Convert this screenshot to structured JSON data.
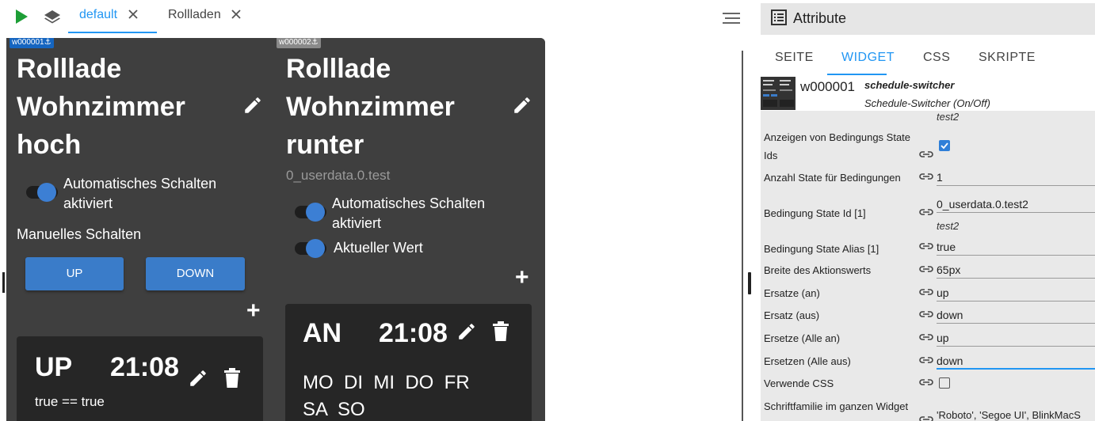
{
  "editor": {
    "tabs": [
      {
        "label": "default",
        "active": true
      },
      {
        "label": "Rollladen",
        "active": false
      }
    ]
  },
  "widgets": [
    {
      "id_label": "w000001⚓",
      "title_lines": [
        "Rolllade",
        "Wohnzimmer",
        "hoch"
      ],
      "auto_switch_label_1": "Automatisches Schalten",
      "auto_switch_label_2": "aktiviert",
      "manual_label": "Manuelles Schalten",
      "btn_up": "UP",
      "btn_down": "DOWN",
      "plus": "+",
      "card": {
        "action": "UP",
        "time": "21:08",
        "condition": "true == true"
      }
    },
    {
      "id_label": "w000002⚓",
      "title_lines": [
        "Rolllade",
        "Wohnzimmer",
        "runter"
      ],
      "subtitle": "0_userdata.0.test",
      "auto_switch_label_1": "Automatisches Schalten",
      "auto_switch_label_2": "aktiviert",
      "current_value_label": "Aktueller Wert",
      "plus": "+",
      "card": {
        "action": "AN",
        "time": "21:08",
        "days_line1": "MO  DI  MI  DO  FR",
        "days_line2": "SA  SO"
      }
    }
  ],
  "panel": {
    "title": "Attribute",
    "tabs": [
      "SEITE",
      "WIDGET",
      "CSS",
      "SKRIPTE"
    ],
    "active_tab": "WIDGET",
    "widget_id": "w000001",
    "widget_type": "schedule-switcher",
    "widget_desc": "Schedule-Switcher (On/Off)",
    "hint_top": "test2",
    "attributes": {
      "show_cond_label_1": "Anzeigen von Bedingungs State",
      "show_cond_label_2": "Ids",
      "show_cond_checked": true,
      "num_states_label": "Anzahl State für Bedingungen",
      "num_states_value": "1",
      "cond_id_label": "Bedingung State Id [1]",
      "cond_id_value": "0_userdata.0.test2",
      "cond_id_hint": "test2",
      "cond_alias_label": "Bedingung State Alias [1]",
      "cond_alias_value": "true",
      "action_width_label": "Breite des Aktionswerts",
      "action_width_value": "65px",
      "replace_on_label": "Ersatze (an)",
      "replace_on_value": "up",
      "replace_off_label": "Ersatz (aus)",
      "replace_off_value": "down",
      "replace_all_on_label": "Ersetze (Alle an)",
      "replace_all_on_value": "up",
      "replace_all_off_label": "Ersetzen (Alle aus)",
      "replace_all_off_value": "down",
      "use_css_label": "Verwende CSS",
      "use_css_checked": false,
      "font_family_label": "Schriftfamilie im ganzen Widget",
      "font_family_value": "'Roboto', 'Segoe UI', BlinkMacS"
    }
  },
  "colors": {
    "accent": "#2196f3",
    "play": "#1d9e36",
    "widget_bg": "#3f3f3f",
    "button": "#3a7cc9",
    "card_bg": "#262626"
  },
  "icons": [
    "play-icon",
    "layers-icon",
    "close-icon",
    "menu-icon",
    "pencil-icon",
    "trash-icon",
    "plus-icon",
    "link-icon",
    "attributes-icon",
    "anchor-icon"
  ]
}
